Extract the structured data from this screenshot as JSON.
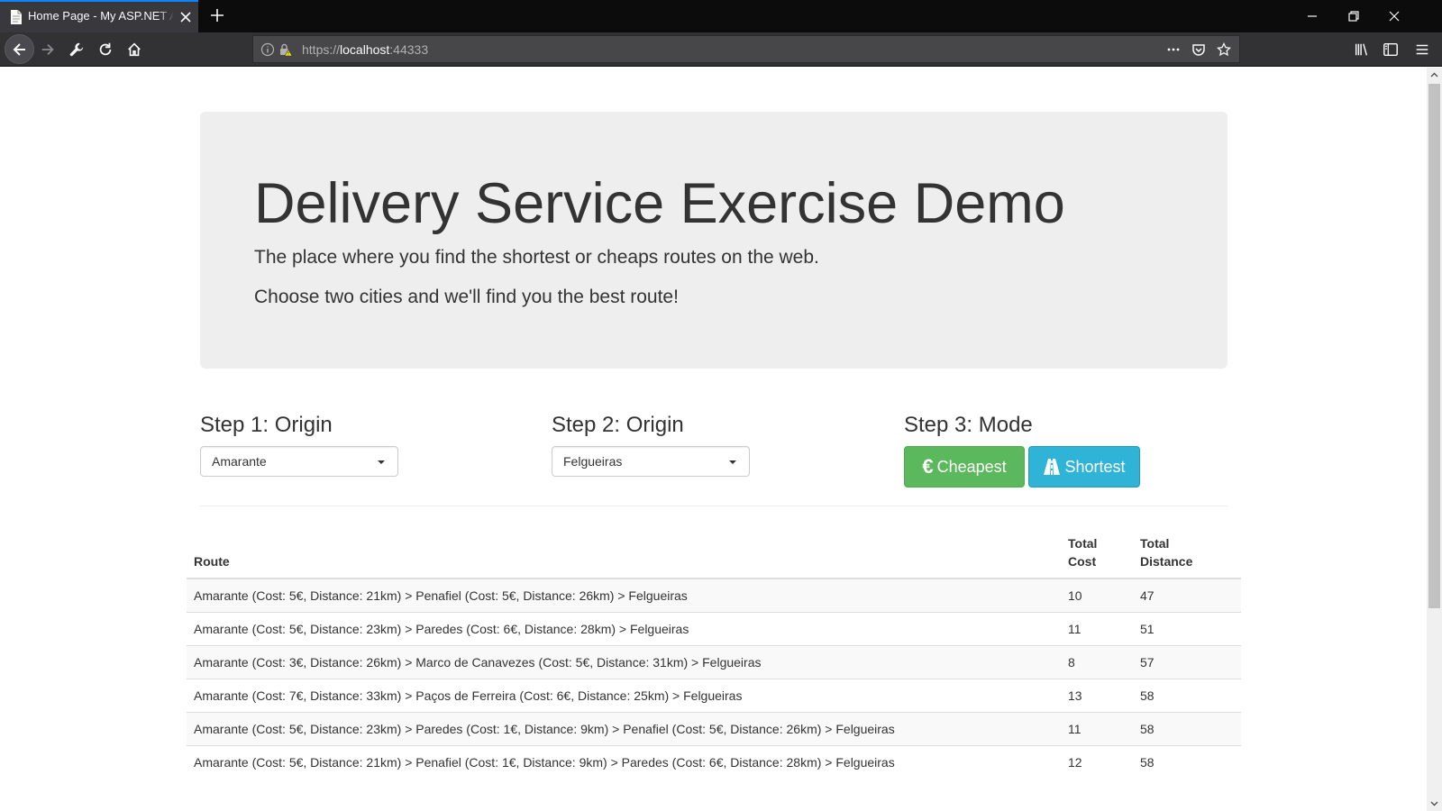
{
  "browser": {
    "tab_title": "Home Page - My ASP.NET Application",
    "url_scheme": "https://",
    "url_host": "localhost",
    "url_port": ":44333"
  },
  "hero": {
    "title": "Delivery Service Exercise Demo",
    "lead1": "The place where you find the shortest or cheaps routes on the web.",
    "lead2": "Choose two cities and we'll find you the best route!"
  },
  "steps": {
    "step1_label": "Step 1: Origin",
    "step1_value": "Amarante",
    "step2_label": "Step 2: Origin",
    "step2_value": "Felgueiras",
    "step3_label": "Step 3: Mode",
    "cheapest_icon": "€",
    "cheapest_label": "Cheapest",
    "shortest_icon": "road-icon",
    "shortest_label": "Shortest"
  },
  "table": {
    "headers": {
      "route": "Route",
      "cost_line1": "Total",
      "cost_line2": "Cost",
      "distance_line1": "Total",
      "distance_line2": "Distance"
    },
    "rows": [
      {
        "route": "Amarante (Cost: 5€, Distance: 21km) > Penafiel (Cost: 5€, Distance: 26km) > Felgueiras",
        "cost": "10",
        "distance": "47"
      },
      {
        "route": "Amarante (Cost: 5€, Distance: 23km) > Paredes (Cost: 6€, Distance: 28km) > Felgueiras",
        "cost": "11",
        "distance": "51"
      },
      {
        "route": "Amarante (Cost: 3€, Distance: 26km) > Marco de Canavezes (Cost: 5€, Distance: 31km) > Felgueiras",
        "cost": "8",
        "distance": "57"
      },
      {
        "route": "Amarante (Cost: 7€, Distance: 33km) > Paços de Ferreira (Cost: 6€, Distance: 25km) > Felgueiras",
        "cost": "13",
        "distance": "58"
      },
      {
        "route": "Amarante (Cost: 5€, Distance: 23km) > Paredes (Cost: 1€, Distance: 9km) > Penafiel (Cost: 5€, Distance: 26km) > Felgueiras",
        "cost": "11",
        "distance": "58"
      },
      {
        "route": "Amarante (Cost: 5€, Distance: 21km) > Penafiel (Cost: 1€, Distance: 9km) > Paredes (Cost: 6€, Distance: 28km) > Felgueiras",
        "cost": "12",
        "distance": "58"
      }
    ]
  },
  "colors": {
    "accent_tab": "#0a84ff",
    "btn_success": "#5cb85c",
    "btn_info": "#2fb4d8",
    "jumbotron_bg": "#eeeeee"
  }
}
